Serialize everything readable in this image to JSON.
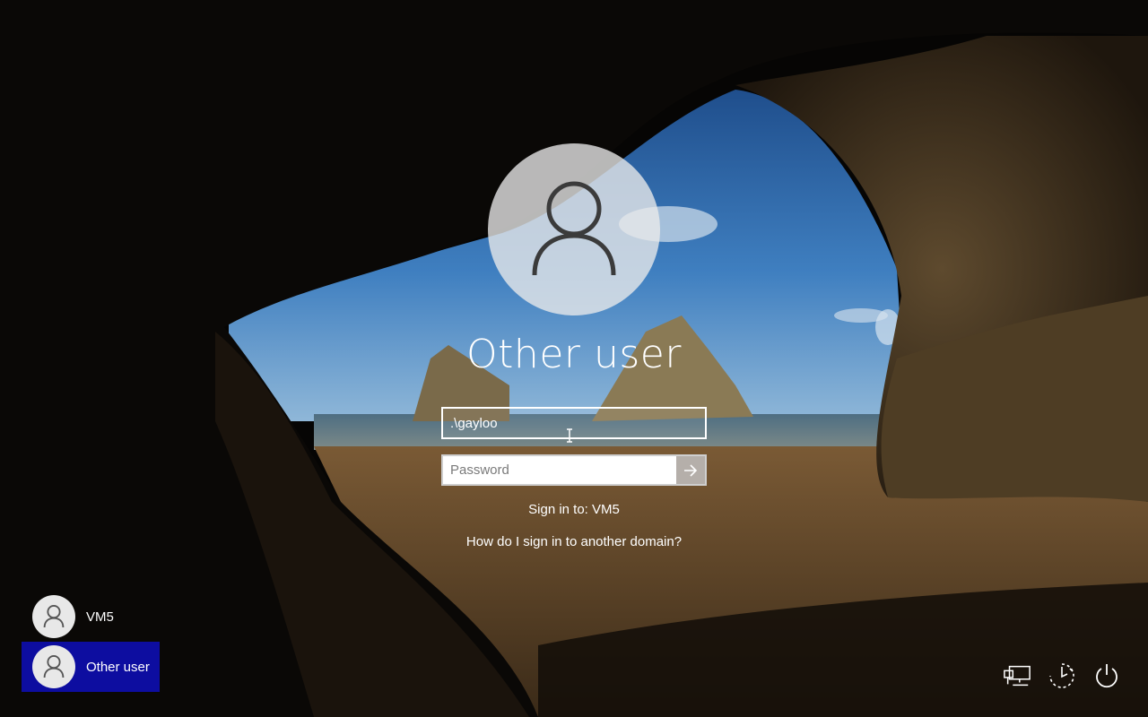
{
  "login": {
    "title": "Other user",
    "username_value": ".\\gayloo",
    "password_placeholder": "Password",
    "sign_in_to": "Sign in to: VM5",
    "domain_help_link": "How do I sign in to another domain?"
  },
  "user_list": [
    {
      "label": "VM5",
      "selected": false
    },
    {
      "label": "Other user",
      "selected": true
    }
  ],
  "system_icons": [
    "network-icon",
    "ease-of-access-icon",
    "power-icon"
  ],
  "colors": {
    "selected_tile": "#0d0da0",
    "field_border": "#ffffff"
  }
}
